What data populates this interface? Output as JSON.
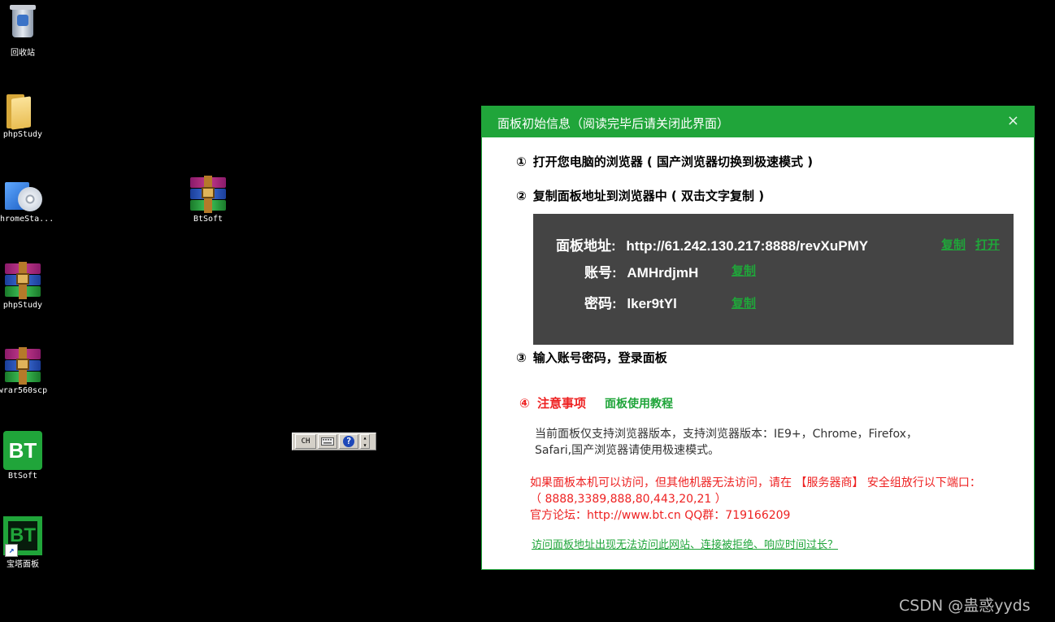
{
  "desktop": {
    "icons": [
      {
        "label": "回收站",
        "icon": "recycle-bin-icon"
      },
      {
        "label": "phpStudy",
        "icon": "folder-icon"
      },
      {
        "label": "hromeSta...",
        "icon": "setup-icon"
      },
      {
        "label": "BtSoft",
        "icon": "winrar-archive-icon"
      },
      {
        "label": "phpStudy",
        "icon": "winrar-archive-icon"
      },
      {
        "label": "wrar560scp",
        "icon": "winrar-archive-icon"
      },
      {
        "label": "BtSoft",
        "icon": "bt-icon"
      },
      {
        "label": "宝塔面板",
        "icon": "bt-panel-shortcut-icon"
      }
    ],
    "bt_icon_text": "BT"
  },
  "langbar": {
    "lang": "CH",
    "help_glyph": "?"
  },
  "dialog": {
    "title": "面板初始信息（阅读完毕后请关闭此界面）",
    "close_glyph": "×",
    "step1": {
      "num": "①",
      "text": "打开您电脑的浏览器 ( 国产浏览器切换到极速模式 )"
    },
    "step2": {
      "num": "②",
      "text": "复制面板地址到浏览器中 ( 双击文字复制 )"
    },
    "info": {
      "address_label": "面板地址:",
      "address_value": "http://61.242.130.217:8888/revXuPMY",
      "account_label": "账号:",
      "account_value": "AMHrdjmH",
      "password_label": "密码:",
      "password_value": "lker9tYl",
      "copy": "复制",
      "open": "打开"
    },
    "step3": {
      "num": "③",
      "text": "输入账号密码，登录面板"
    },
    "notice": {
      "num": "④",
      "title": "注意事项",
      "tutorial": "面板使用教程",
      "support_line1": "当前面板仅支持浏览器版本，支持浏览器版本：IE9+，Chrome，Firefox，",
      "support_line2": "Safari,国产浏览器请使用极速模式。",
      "warn_line1": "如果面板本机可以访问，但其他机器无法访问，请在 【服务器商】 安全组放行以下端口：",
      "warn_line2": "（ 8888,3389,888,80,443,20,21 ）",
      "warn_line3": "官方论坛：http://www.bt.cn  QQ群：719166209",
      "help_link": "访问面板地址出现无法访问此网站、连接被拒绝、响应时间过长？"
    },
    "colors": {
      "accent": "#20a53a",
      "info_bg": "#444444",
      "warning": "#ee2222"
    }
  },
  "watermark": "CSDN @蛊惑yyds"
}
